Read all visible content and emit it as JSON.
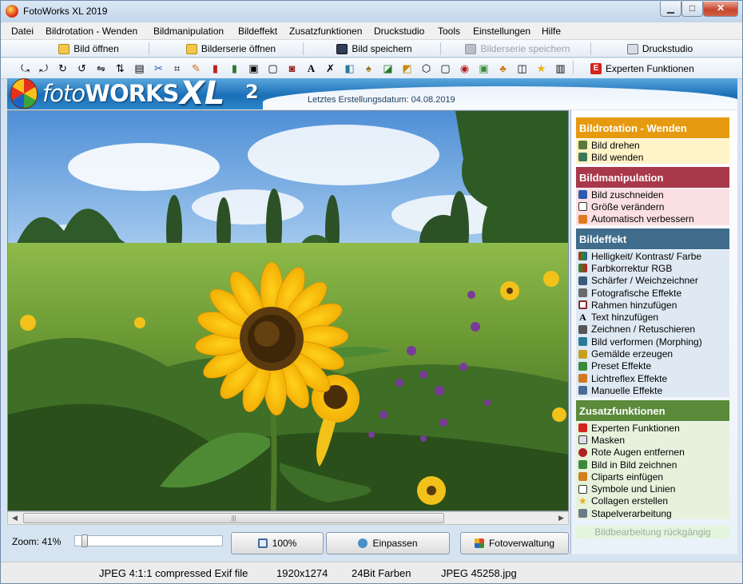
{
  "window": {
    "title": "FotoWorks XL 2019",
    "controls": {
      "minimize": "▁",
      "maximize": "□",
      "close": "✕"
    }
  },
  "menu": [
    {
      "label": "Datei"
    },
    {
      "label": "Bildrotation - Wenden"
    },
    {
      "label": "Bildmanipulation"
    },
    {
      "label": "Bildeffekt"
    },
    {
      "label": "Zusatzfunktionen"
    },
    {
      "label": "Druckstudio"
    },
    {
      "label": "Tools"
    },
    {
      "label": "Einstellungen"
    },
    {
      "label": "Hilfe"
    }
  ],
  "main_toolbar": {
    "open_image": "Bild öffnen",
    "open_series": "Bilderserie öffnen",
    "save_image": "Bild speichern",
    "save_series": "Bilderserie speichern",
    "print_studio": "Druckstudio"
  },
  "tools_toolbar": {
    "icons": [
      "rotate-left-icon",
      "rotate-right-icon",
      "rotate-ccw-icon",
      "rotate-cw-icon",
      "flip-horizontal-icon",
      "flip-vertical-icon",
      "scanner-icon",
      "crop-icon",
      "resize-icon",
      "auto-enhance-icon",
      "rgb-levels-icon",
      "sharpen-icon",
      "photo-effects-icon",
      "frame-icon",
      "text-icon",
      "draw-icon",
      "morph-icon",
      "painting-icon",
      "preset-icon",
      "lens-flare-icon",
      "manual-effects-icon",
      "mask-icon",
      "red-eye-icon",
      "picture-in-picture-icon",
      "clipart-icon",
      "shapes-icon",
      "collage-icon",
      "batch-icon"
    ],
    "expert_label": "Experten Funktionen",
    "expert_badge": "E"
  },
  "banner": {
    "logo_foto": "foto",
    "logo_works": "WORKS",
    "logo_xl": "XL",
    "logo_num": "2",
    "build_date": "Letztes Erstellungsdatum: 04.08.2019"
  },
  "zoom": {
    "label": "Zoom: 41%",
    "slider_fraction": 0.02
  },
  "bottom_buttons": {
    "full_size": "100%",
    "fit": "Einpassen",
    "photo_manager": "Fotoverwaltung"
  },
  "side_panel": {
    "sections": [
      {
        "title": "Bildrotation - Wenden",
        "color": "#e69a0f",
        "bg": "#fff3c8",
        "items": [
          "Bild drehen",
          "Bild wenden"
        ]
      },
      {
        "title": "Bildmanipulation",
        "color": "#a8384a",
        "bg": "#fbe0e3",
        "items": [
          "Bild zuschneiden",
          "Größe verändern",
          "Automatisch verbessern"
        ]
      },
      {
        "title": "Bildeffekt",
        "color": "#3f6d8b",
        "bg": "#dfe9f3",
        "items": [
          "Helligkeit/ Kontrast/ Farbe",
          "Farbkorrektur RGB",
          "Schärfer / Weichzeichner",
          "Fotografische Effekte",
          "Rahmen hinzufügen",
          "Text hinzufügen",
          "Zeichnen / Retuschieren",
          "Bild verformen (Morphing)",
          "Gemälde erzeugen",
          "Preset Effekte",
          "Lichtreflex Effekte",
          "Manuelle Effekte"
        ]
      },
      {
        "title": "Zusatzfunktionen",
        "color": "#5b8a3a",
        "bg": "#e7f2dd",
        "items": [
          "Experten Funktionen",
          "Masken",
          "Rote Augen entfernen",
          "Bild in Bild zeichnen",
          "Cliparts einfügen",
          "Symbole und Linien",
          "Collagen erstellen",
          "Stapelverarbeitung"
        ]
      }
    ],
    "undo_label": "Bildbearbeitung rückgängig"
  },
  "status": {
    "format": "JPEG 4:1:1 compressed Exif file",
    "dimensions": "1920x1274",
    "color_depth": "24Bit Farben",
    "filename": "JPEG 45258.jpg"
  }
}
